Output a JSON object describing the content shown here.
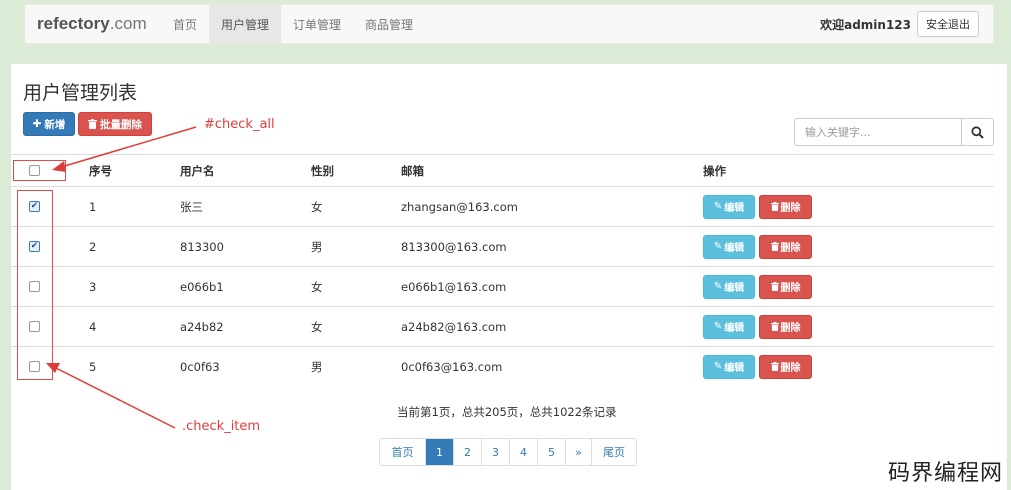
{
  "navbar": {
    "brand_bold": "refectory",
    "brand_rest": ".com",
    "items": [
      {
        "label": "首页",
        "active": false
      },
      {
        "label": "用户管理",
        "active": true
      },
      {
        "label": "订单管理",
        "active": false
      },
      {
        "label": "商品管理",
        "active": false
      }
    ],
    "welcome": "欢迎admin123",
    "logout_label": "安全退出"
  },
  "page": {
    "title": "用户管理列表",
    "add_label": "新增",
    "batch_delete_label": "批量删除",
    "search_placeholder": "输入关键字..."
  },
  "table": {
    "headers": {
      "no": "序号",
      "name": "用户名",
      "sex": "性别",
      "email": "邮箱",
      "ops": "操作"
    },
    "rows": [
      {
        "checked": true,
        "no": "1",
        "name": "张三",
        "sex": "女",
        "email": "zhangsan@163.com"
      },
      {
        "checked": true,
        "no": "2",
        "name": "813300",
        "sex": "男",
        "email": "813300@163.com"
      },
      {
        "checked": false,
        "no": "3",
        "name": "e066b1",
        "sex": "女",
        "email": "e066b1@163.com"
      },
      {
        "checked": false,
        "no": "4",
        "name": "a24b82",
        "sex": "女",
        "email": "a24b82@163.com"
      },
      {
        "checked": false,
        "no": "5",
        "name": "0c0f63",
        "sex": "男",
        "email": "0c0f63@163.com"
      }
    ],
    "edit_label": "编辑",
    "delete_label": "删除"
  },
  "pager": {
    "info": "当前第1页，总共205页，总共1022条记录",
    "first_label": "首页",
    "pages": [
      "1",
      "2",
      "3",
      "4",
      "5"
    ],
    "active_page": "1",
    "next_label": "»",
    "last_label": "尾页"
  },
  "annotations": {
    "check_all": "#check_all",
    "check_item": ".check_item",
    "color": "#e03c3c"
  },
  "watermark": "码界编程网"
}
